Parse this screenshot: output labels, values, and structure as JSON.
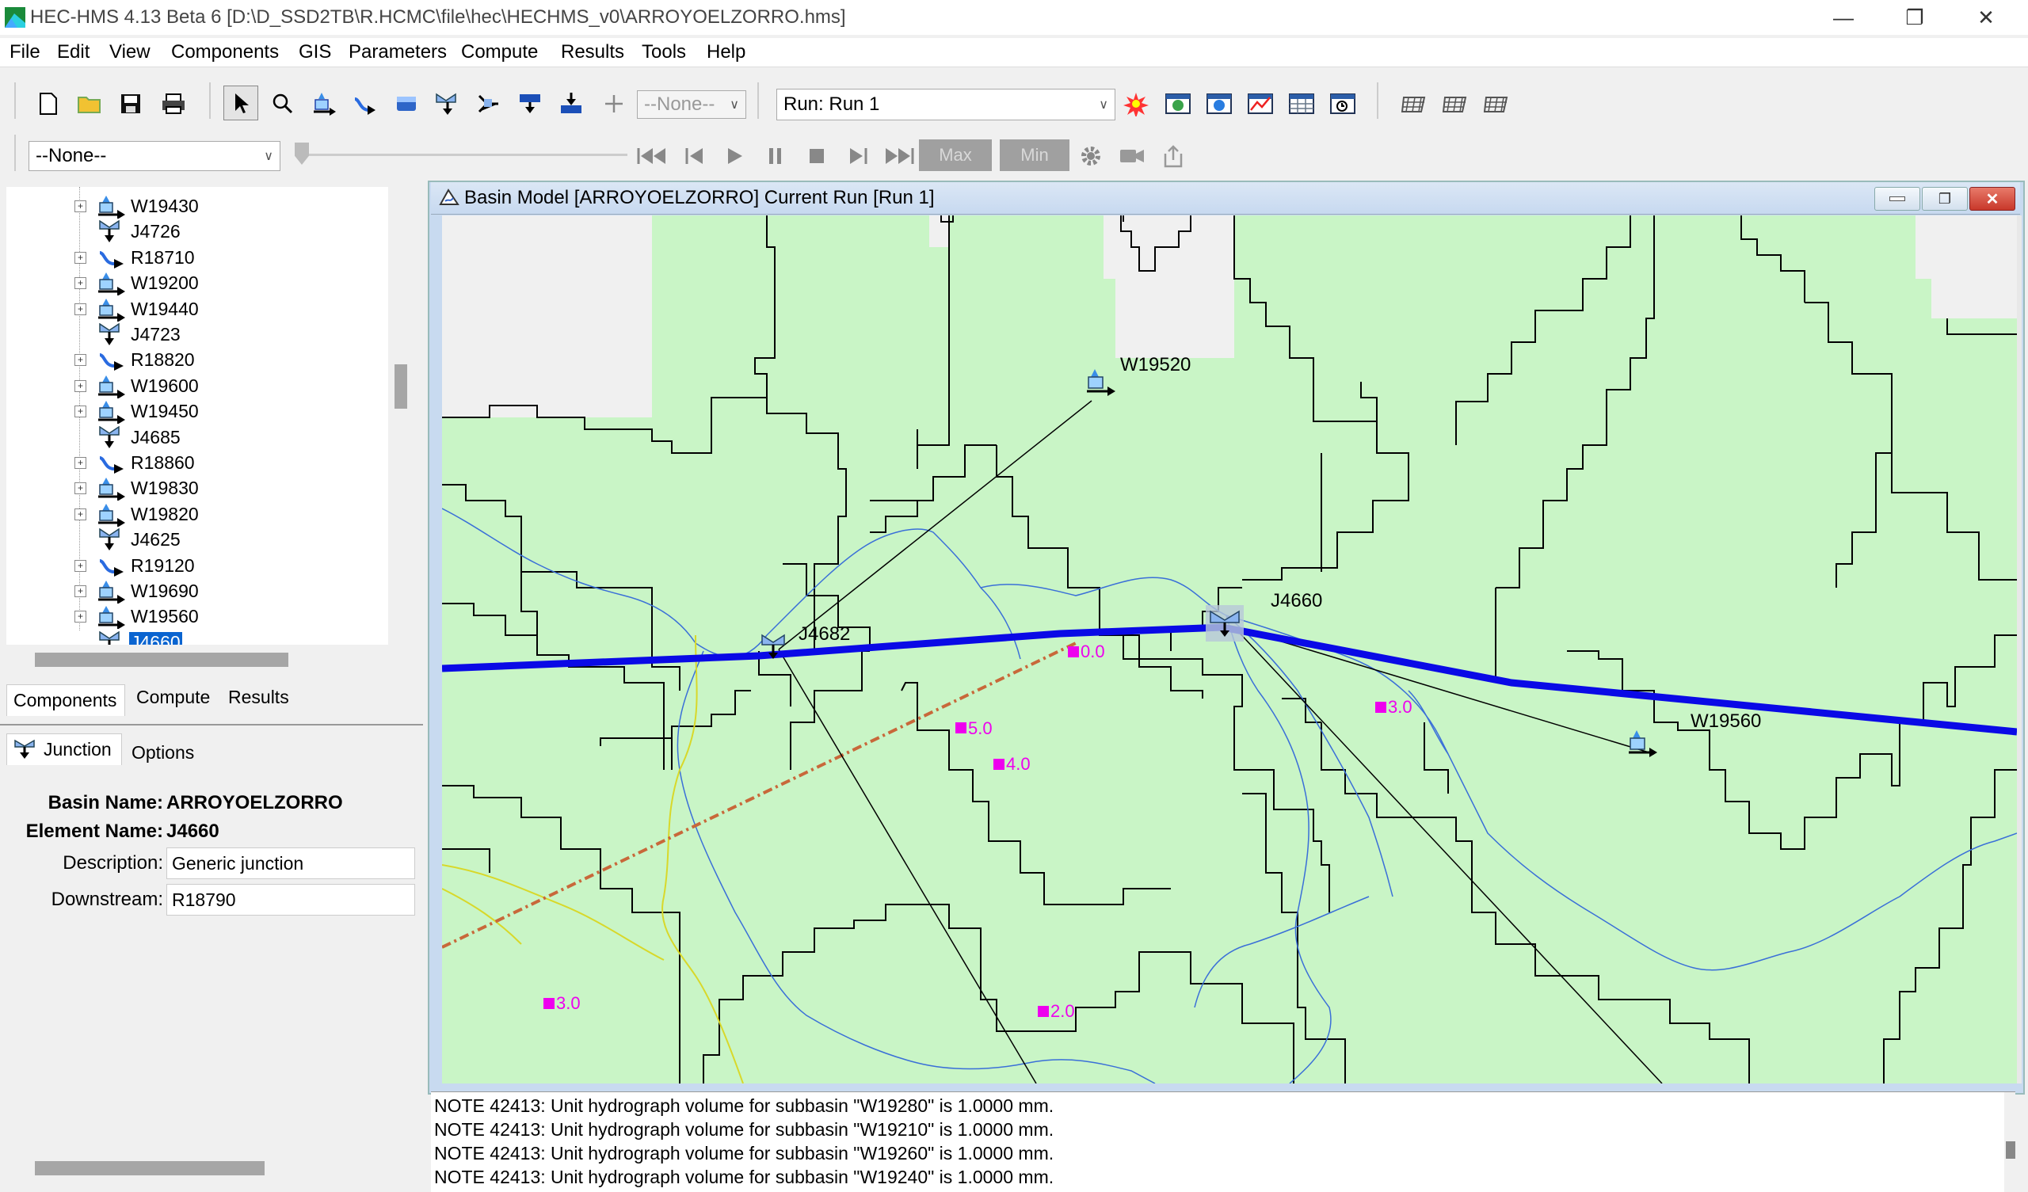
{
  "window": {
    "title": "HEC-HMS 4.13 Beta 6 [D:\\D_SSD2TB\\R.HCMC\\file\\hec\\HECHMS_v0\\ARROYOELZORRO.hms]",
    "minimize_icon": "minimize-icon",
    "restore_icon": "restore-icon",
    "close_icon": "close-icon"
  },
  "menu": [
    "File",
    "Edit",
    "View",
    "Components",
    "GIS",
    "Parameters",
    "Compute",
    "Results",
    "Tools",
    "Help"
  ],
  "toolbar": {
    "element_select": "--None--",
    "run_select": "Run: Run 1",
    "time_select": "--None--",
    "max_label": "Max",
    "min_label": "Min"
  },
  "tree": [
    {
      "label": "W19430",
      "type": "subbasin",
      "expandable": true
    },
    {
      "label": "J4726",
      "type": "junction",
      "expandable": false
    },
    {
      "label": "R18710",
      "type": "reach",
      "expandable": true
    },
    {
      "label": "W19200",
      "type": "subbasin",
      "expandable": true
    },
    {
      "label": "W19440",
      "type": "subbasin",
      "expandable": true
    },
    {
      "label": "J4723",
      "type": "junction",
      "expandable": false
    },
    {
      "label": "R18820",
      "type": "reach",
      "expandable": true
    },
    {
      "label": "W19600",
      "type": "subbasin",
      "expandable": true
    },
    {
      "label": "W19450",
      "type": "subbasin",
      "expandable": true
    },
    {
      "label": "J4685",
      "type": "junction",
      "expandable": false
    },
    {
      "label": "R18860",
      "type": "reach",
      "expandable": true
    },
    {
      "label": "W19830",
      "type": "subbasin",
      "expandable": true
    },
    {
      "label": "W19820",
      "type": "subbasin",
      "expandable": true
    },
    {
      "label": "J4625",
      "type": "junction",
      "expandable": false
    },
    {
      "label": "R19120",
      "type": "reach",
      "expandable": true
    },
    {
      "label": "W19690",
      "type": "subbasin",
      "expandable": true
    },
    {
      "label": "W19560",
      "type": "subbasin",
      "expandable": true
    },
    {
      "label": "J4660",
      "type": "junction",
      "expandable": false,
      "selected": true
    }
  ],
  "tabs": [
    "Components",
    "Compute",
    "Results"
  ],
  "props_tabs": [
    "Junction",
    "Options"
  ],
  "props": {
    "basin_label": "Basin Name:",
    "basin_value": "ARROYOELZORRO",
    "element_label": "Element Name:",
    "element_value": "J4660",
    "description_label": "Description:",
    "description_value": "Generic junction",
    "downstream_label": "Downstream:",
    "downstream_value": "R18790"
  },
  "inner_window": {
    "title": "Basin Model [ARROYOELZORRO] Current Run [Run 1]"
  },
  "map": {
    "labels": {
      "w19520": "W19520",
      "j4682": "J4682",
      "j4660": "J4660",
      "w19560": "W19560"
    },
    "gauges": [
      "0.0",
      "5.0",
      "4.0",
      "3.0",
      "3.0",
      "2.0"
    ],
    "colors": {
      "fill": "#c9f5c6",
      "background": "#f0f0f0",
      "river": "#3a6fd8",
      "main_reach": "#0a0ae6",
      "gauge": "#ee00ee",
      "dashed": "#c8683a"
    }
  },
  "log": [
    "NOTE 42413:  Unit hydrograph volume for subbasin \"W19280\" is 1.0000 mm.",
    "NOTE 42413:  Unit hydrograph volume for subbasin \"W19210\" is 1.0000 mm.",
    "NOTE 42413:  Unit hydrograph volume for subbasin \"W19260\" is 1.0000 mm.",
    "NOTE 42413:  Unit hydrograph volume for subbasin \"W19240\" is 1.0000 mm."
  ]
}
